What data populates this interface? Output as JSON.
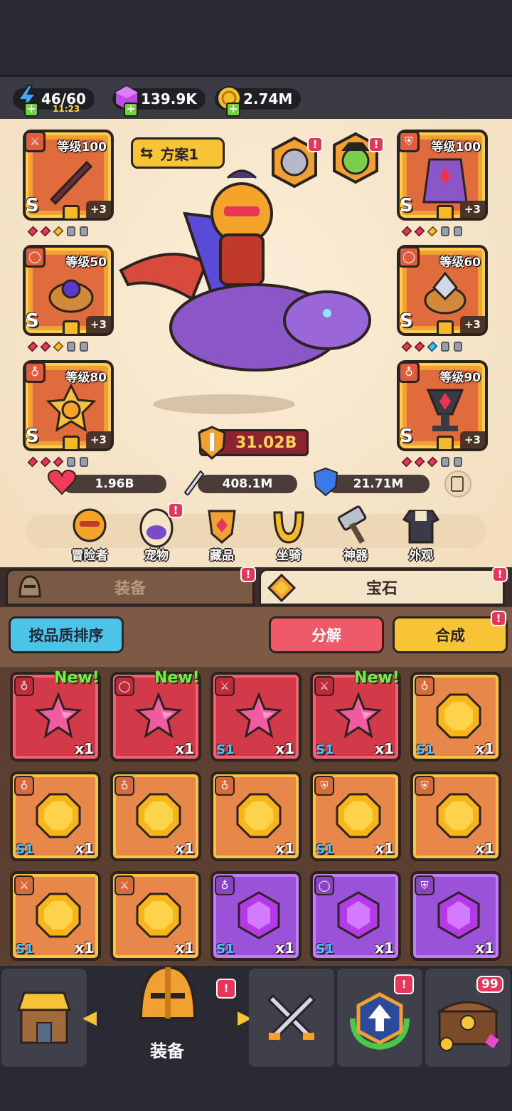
{
  "resources": {
    "energy": {
      "value": "46/60",
      "timer": "11:23",
      "icon": "lightning-icon"
    },
    "gems": {
      "value": "139.9K",
      "icon": "purple-gem-icon"
    },
    "gold": {
      "value": "2.74M",
      "icon": "gold-coin-icon"
    }
  },
  "hero": {
    "scheme_label": "方案1",
    "power": "31.02B",
    "stats": {
      "hp": "1.96B",
      "attack": "408.1M",
      "defense": "21.71M"
    },
    "equipment_left": [
      {
        "level": "等级100",
        "rank": "S",
        "bonus": "+3",
        "slot_icon": "sword-icon"
      },
      {
        "level": "等级50",
        "rank": "S",
        "bonus": "+3",
        "slot_icon": "ring-icon"
      },
      {
        "level": "等级80",
        "rank": "S",
        "bonus": "+3",
        "slot_icon": "amulet-icon"
      }
    ],
    "equipment_right": [
      {
        "level": "等级100",
        "rank": "S",
        "bonus": "+3",
        "slot_icon": "armor-icon"
      },
      {
        "level": "等级60",
        "rank": "S",
        "bonus": "+3",
        "slot_icon": "ring-icon"
      },
      {
        "level": "等级90",
        "rank": "S",
        "bonus": "+3",
        "slot_icon": "amulet-icon"
      }
    ]
  },
  "subnav": {
    "items": [
      {
        "label": "冒险者",
        "icon": "adventurer-icon"
      },
      {
        "label": "宠物",
        "icon": "pet-egg-icon"
      },
      {
        "label": "藏品",
        "icon": "collection-icon"
      },
      {
        "label": "坐骑",
        "icon": "mount-icon"
      },
      {
        "label": "神器",
        "icon": "artifact-hammer-icon"
      },
      {
        "label": "外观",
        "icon": "outfit-icon"
      }
    ]
  },
  "tabs": {
    "equipment": "装备",
    "gems": "宝石"
  },
  "actions": {
    "sort": "按品质排序",
    "decompose": "分解",
    "merge": "合成"
  },
  "inventory": {
    "new_label": "New!",
    "items": [
      {
        "color": "red",
        "gem": "star",
        "tag": "amulet",
        "count": "x1",
        "tier": "",
        "new": true
      },
      {
        "color": "red",
        "gem": "star",
        "tag": "ring",
        "count": "x1",
        "tier": "",
        "new": true
      },
      {
        "color": "red",
        "gem": "star",
        "tag": "sword",
        "count": "x1",
        "tier": "S1",
        "new": false
      },
      {
        "color": "red",
        "gem": "star",
        "tag": "sword",
        "count": "x1",
        "tier": "S1",
        "new": true
      },
      {
        "color": "orange",
        "gem": "yellow",
        "tag": "amulet",
        "count": "x1",
        "tier": "S1",
        "new": false
      },
      {
        "color": "orange",
        "gem": "yellow",
        "tag": "amulet",
        "count": "x1",
        "tier": "S1",
        "new": false
      },
      {
        "color": "orange",
        "gem": "yellow",
        "tag": "amulet",
        "count": "x1",
        "tier": "",
        "new": false
      },
      {
        "color": "orange",
        "gem": "yellow",
        "tag": "amulet",
        "count": "x1",
        "tier": "",
        "new": false
      },
      {
        "color": "orange",
        "gem": "yellow",
        "tag": "armor",
        "count": "x1",
        "tier": "S1",
        "new": false
      },
      {
        "color": "orange",
        "gem": "yellow",
        "tag": "armor",
        "count": "x1",
        "tier": "",
        "new": false
      },
      {
        "color": "orange",
        "gem": "yellow",
        "tag": "sword",
        "count": "x1",
        "tier": "S1",
        "new": false
      },
      {
        "color": "orange",
        "gem": "yellow",
        "tag": "sword",
        "count": "x1",
        "tier": "",
        "new": false
      },
      {
        "color": "purple",
        "gem": "purple",
        "tag": "amulet",
        "count": "x1",
        "tier": "S1",
        "new": false
      },
      {
        "color": "purple",
        "gem": "purple",
        "tag": "ring",
        "count": "x1",
        "tier": "S1",
        "new": false
      },
      {
        "color": "purple",
        "gem": "purple",
        "tag": "armor",
        "count": "x1",
        "tier": "",
        "new": false
      }
    ]
  },
  "bottom_nav": {
    "items": [
      {
        "label": "",
        "icon": "shop-icon"
      },
      {
        "label": "装备",
        "icon": "helmet-icon",
        "active": true
      },
      {
        "label": "",
        "icon": "crossed-swords-icon"
      },
      {
        "label": "",
        "icon": "upgrade-arrow-icon"
      },
      {
        "label": "",
        "icon": "treasure-chest-icon",
        "badge": "99"
      }
    ]
  }
}
